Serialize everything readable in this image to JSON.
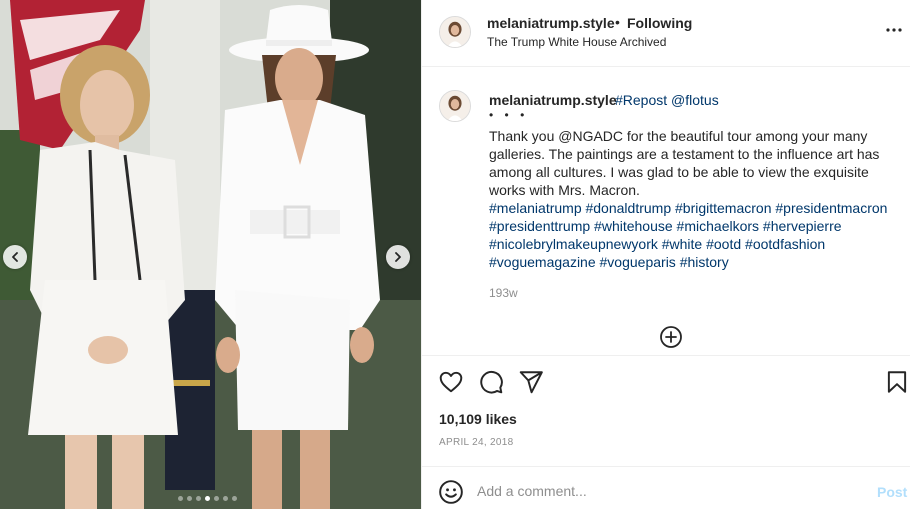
{
  "header": {
    "username": "melaniatrump.style",
    "separator": "•",
    "follow_status": "Following",
    "location": "The Trump White House Archived",
    "more_icon": "more-horizontal-icon"
  },
  "carousel": {
    "prev_icon": "chevron-left-icon",
    "next_icon": "chevron-right-icon",
    "dot_count": 7,
    "active_dot": 3
  },
  "caption": {
    "username": "melaniatrump.style",
    "repost_text": "#Repost @flotus",
    "bullets": "• • •",
    "text": "Thank you @NGADC for the beautiful tour among your many galleries. The paintings are a testament to the influence art has among all cultures. I was glad to be able to view the exquisite works with Mrs. Macron.",
    "hashtags": "#melaniatrump #donaldtrump #brigittemacron #presidentmacron #presidenttrump #whitehouse #michaelkors #hervepierre #nicolebrylmakeupnewyork #white #ootd #ootdfashion #voguemagazine #vogueparis #history",
    "time_ago": "193w",
    "load_more_icon": "plus-circle-icon"
  },
  "actions": {
    "like_icon": "heart-icon",
    "comment_icon": "comment-bubble-icon",
    "share_icon": "paper-plane-icon",
    "save_icon": "bookmark-icon",
    "likes": "10,109 likes",
    "date": "APRIL 24, 2018"
  },
  "add_comment": {
    "emoji_icon": "emoji-smile-icon",
    "placeholder": "Add a comment...",
    "post_label": "Post"
  },
  "colors": {
    "link": "#00376b",
    "muted": "#8e8e8e",
    "post_disabled": "#b2dffc",
    "border": "#efefef"
  }
}
